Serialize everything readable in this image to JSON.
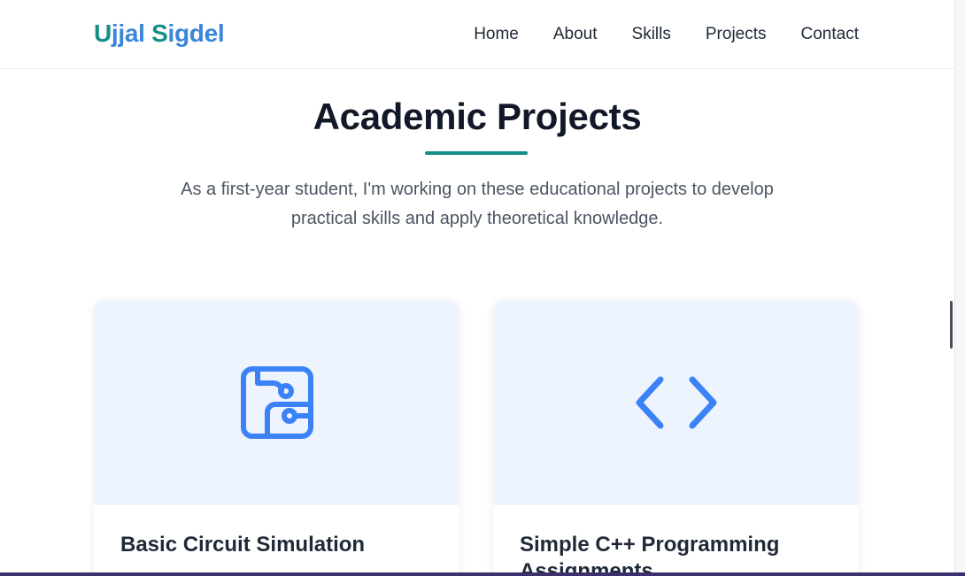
{
  "header": {
    "logo_first": "Ujjal",
    "logo_last": "Sigdel",
    "nav": [
      "Home",
      "About",
      "Skills",
      "Projects",
      "Contact"
    ]
  },
  "section": {
    "title": "Academic Projects",
    "intro": "As a first-year student, I'm working on these educational projects to develop practical skills and apply theoretical knowledge."
  },
  "projects": [
    {
      "title": "Basic Circuit Simulation",
      "icon": "circuit-board-icon"
    },
    {
      "title": "Simple C++ Programming Assignments",
      "icon": "code-icon"
    }
  ],
  "colors": {
    "accent_teal": "#148f86",
    "accent_blue": "#3b82f6",
    "card_media_bg": "#eef4fe",
    "heading": "#111827"
  }
}
